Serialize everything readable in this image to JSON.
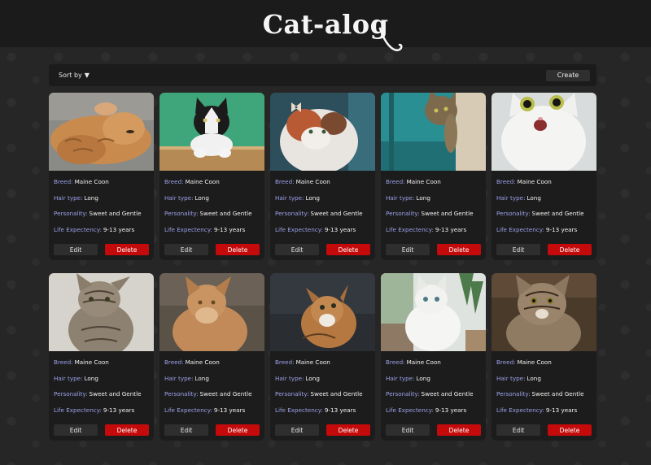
{
  "header": {
    "logo_text": "Cat-alog"
  },
  "toolbar": {
    "sort_label": "Sort by",
    "sort_arrow": "▼",
    "create_label": "Create"
  },
  "card_labels": {
    "breed": "Breed:",
    "hair": "Hair type:",
    "personality": "Personality:",
    "life": "Life Expectency:",
    "edit": "Edit",
    "delete": "Delete"
  },
  "colors": {
    "accent_label": "#9aa1e8",
    "delete": "#c40a0a",
    "card": "#1c1c1c",
    "header": "#1b1b1b"
  },
  "cats": [
    {
      "breed": "Maine Coon",
      "hair": "Long",
      "personality": "Sweet and Gentle",
      "life": "9-13 years",
      "photo": "orange-tabby-lying"
    },
    {
      "breed": "Maine Coon",
      "hair": "Long",
      "personality": "Sweet and Gentle",
      "life": "9-13 years",
      "photo": "black-white-cat-green-bg"
    },
    {
      "breed": "Maine Coon",
      "hair": "Long",
      "personality": "Sweet and Gentle",
      "life": "9-13 years",
      "photo": "calico-fluffy-butterfly"
    },
    {
      "breed": "Maine Coon",
      "hair": "Long",
      "personality": "Sweet and Gentle",
      "life": "9-13 years",
      "photo": "tabby-peeking-teal"
    },
    {
      "breed": "Maine Coon",
      "hair": "Long",
      "personality": "Sweet and Gentle",
      "life": "9-13 years",
      "photo": "white-surprised-cat"
    },
    {
      "breed": "Maine Coon",
      "hair": "Long",
      "personality": "Sweet and Gentle",
      "life": "9-13 years",
      "photo": "tabby-kitten"
    },
    {
      "breed": "Maine Coon",
      "hair": "Long",
      "personality": "Sweet and Gentle",
      "life": "9-13 years",
      "photo": "ginger-maine-coon"
    },
    {
      "breed": "Maine Coon",
      "hair": "Long",
      "personality": "Sweet and Gentle",
      "life": "9-13 years",
      "photo": "orange-cat-looking-up"
    },
    {
      "breed": "Maine Coon",
      "hair": "Long",
      "personality": "Sweet and Gentle",
      "life": "9-13 years",
      "photo": "white-persian-kitten"
    },
    {
      "breed": "Maine Coon",
      "hair": "Long",
      "personality": "Sweet and Gentle",
      "life": "9-13 years",
      "photo": "tabby-cat-portrait"
    }
  ]
}
